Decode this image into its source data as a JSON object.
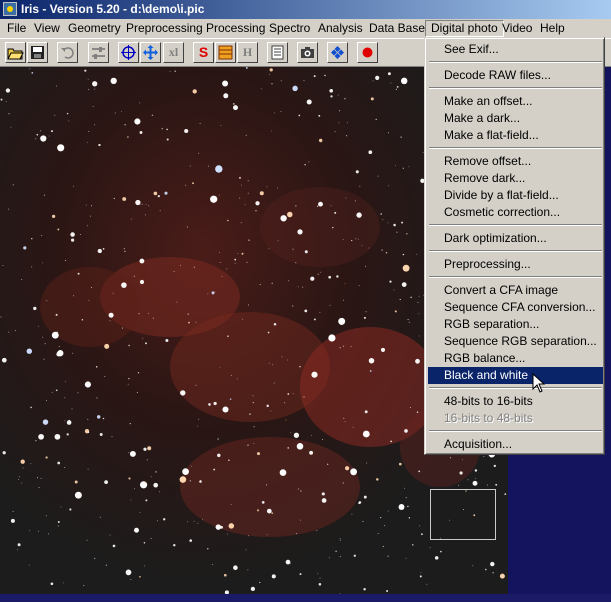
{
  "window": {
    "title": "Iris - Version 5.20 - d:\\demo\\i.pic"
  },
  "menubar": {
    "items": [
      {
        "label": "File"
      },
      {
        "label": "View"
      },
      {
        "label": "Geometry"
      },
      {
        "label": "Preprocessing"
      },
      {
        "label": "Processing"
      },
      {
        "label": "Spectro"
      },
      {
        "label": "Analysis"
      },
      {
        "label": "Data Base"
      },
      {
        "label": "Digital photo"
      },
      {
        "label": "Video"
      },
      {
        "label": "Help"
      }
    ],
    "open_menu": "Digital photo"
  },
  "toolbar": {
    "buttons": [
      {
        "icon": "open-folder-icon"
      },
      {
        "icon": "save-disk-icon"
      },
      {
        "icon": "undo-icon"
      },
      {
        "icon": "threshold-sliders-icon"
      },
      {
        "icon": "crosshair-icon"
      },
      {
        "icon": "move-arrows-icon"
      },
      {
        "icon": "xl-icon",
        "text": "xl"
      },
      {
        "icon": "red-s-icon",
        "text": "S"
      },
      {
        "icon": "orange-grid-icon"
      },
      {
        "icon": "h-icon",
        "text": "H"
      },
      {
        "icon": "list-icon"
      },
      {
        "icon": "camera-icon"
      },
      {
        "icon": "blue-diamond-icon"
      },
      {
        "icon": "record-dot-icon"
      }
    ]
  },
  "digital_photo_menu": {
    "groups": [
      [
        "See Exif..."
      ],
      [
        "Decode RAW files..."
      ],
      [
        "Make an offset...",
        "Make a dark...",
        "Make a flat-field..."
      ],
      [
        "Remove offset...",
        "Remove dark...",
        "Divide by a flat-field...",
        "Cosmetic correction..."
      ],
      [
        "Dark optimization..."
      ],
      [
        "Preprocessing..."
      ],
      [
        "Convert a CFA image",
        "Sequence CFA conversion...",
        "RGB separation...",
        "Sequence RGB separation...",
        "RGB balance...",
        "Black and white"
      ],
      [
        "48-bits to 16-bits",
        "16-bits to 48-bits"
      ],
      [
        "Acquisition..."
      ]
    ],
    "highlighted": "Black and white",
    "disabled": [
      "16-bits to 48-bits"
    ]
  },
  "colors": {
    "menu_bg": "#d4d0c8",
    "highlight": "#0a246a",
    "title_gradient_start": "#0a246a",
    "title_gradient_end": "#a6caf0",
    "desktop_bg": "#1a1a66"
  }
}
